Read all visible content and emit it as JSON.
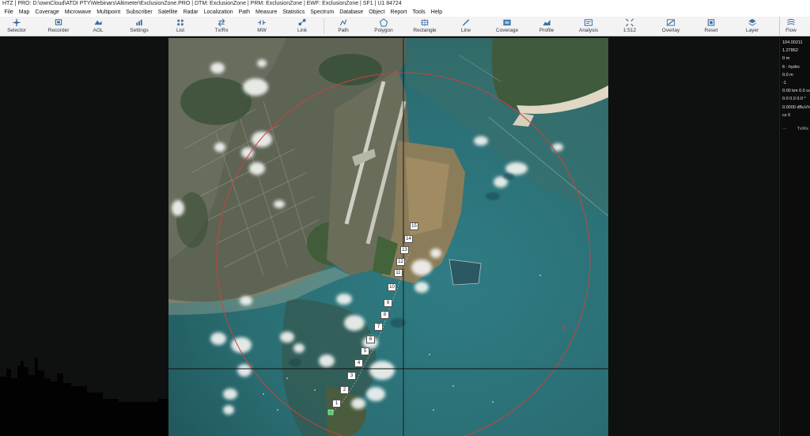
{
  "window": {
    "title": "HTZ | PRO: D:\\ownCloud\\ATDI PTY\\Webinars\\Altimeter\\ExclusionZone.PRO | DTM: ExclusionZone | PRM: ExclusionZone | EWF: ExclusionZone | SF1 | U1 84724"
  },
  "menu": [
    "File",
    "Map",
    "Coverage",
    "Microwave",
    "Multipoint",
    "Subscriber",
    "Satellite",
    "Radar",
    "Localization",
    "Path",
    "Measure",
    "Statistics",
    "Spectrum",
    "Database",
    "Object",
    "Report",
    "Tools",
    "Help"
  ],
  "toolbar": [
    {
      "label": "Selector",
      "icon": "selector-icon"
    },
    {
      "label": "Recorder",
      "icon": "recorder-icon"
    },
    {
      "label": "AGL",
      "icon": "agl-icon"
    },
    {
      "label": "Settings",
      "icon": "settings-icon"
    },
    {
      "label": "List",
      "icon": "list-icon"
    },
    {
      "label": "Tx/Rx",
      "icon": "txrx-icon"
    },
    {
      "label": "MW",
      "icon": "mw-icon"
    },
    {
      "label": "Link",
      "icon": "link-icon"
    },
    {
      "label": "Path",
      "icon": "path-icon"
    },
    {
      "label": "Polygon",
      "icon": "polygon-icon"
    },
    {
      "label": "Rectangle",
      "icon": "rectangle-icon"
    },
    {
      "label": "Line",
      "icon": "line-icon"
    },
    {
      "label": "Coverage",
      "icon": "coverage-icon"
    },
    {
      "label": "Profile",
      "icon": "profile-icon"
    },
    {
      "label": "Analysis",
      "icon": "analysis-icon"
    },
    {
      "label": "1:512",
      "icon": "zoom-fit-icon"
    },
    {
      "label": "Overlay",
      "icon": "overlay-icon"
    },
    {
      "label": "Reset",
      "icon": "reset-icon"
    },
    {
      "label": "Layer",
      "icon": "layer-icon"
    },
    {
      "label": "Flow",
      "icon": "flow-icon"
    }
  ],
  "right_panel": {
    "values": [
      "104.00211",
      "1.27862",
      "0 m",
      "6 - hydro",
      "0.0 m",
      "-1",
      "0.00 km 0.0 us",
      "0.0 0.0 0.0 °",
      "0.0000 dBuV/m",
      "cx 0"
    ],
    "sub_label_left": "···",
    "sub_label_right": "Tx/Rx"
  },
  "map": {
    "markers": [
      "1",
      "2",
      "3",
      "4",
      "5",
      "6",
      "7",
      "8",
      "9",
      "10",
      "11",
      "12",
      "13",
      "14",
      "15"
    ],
    "colors": {
      "circle": "#c8423f",
      "crosshair": "#111111",
      "sea": "#2e7077",
      "land": "#4e5b45"
    }
  }
}
